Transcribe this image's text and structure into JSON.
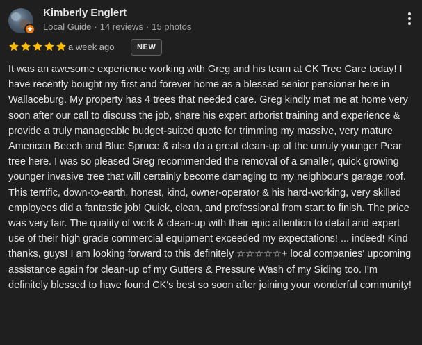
{
  "review": {
    "author": {
      "name": "Kimberly Englert",
      "badge": "Local Guide",
      "reviews": "14 reviews",
      "photos": "15 photos",
      "separator": "·"
    },
    "rating": {
      "stars": 5,
      "max": 5,
      "color": "#fbbc04"
    },
    "date": "a week ago",
    "new_badge": "NEW",
    "text": "It was an awesome experience working with Greg and his team at CK Tree Care today! I have recently bought my first and forever home as a blessed senior pensioner here in Wallaceburg. My property has 4 trees that needed care. Greg kindly met me at home very soon after our call to discuss the job, share his expert arborist training and experience & provide a truly manageable budget-suited quote for trimming my massive, very mature American Beech and Blue Spruce & also do a great clean-up of the unruly younger Pear tree here. I was so pleased Greg recommended the removal of a smaller, quick growing younger invasive tree that will certainly become damaging to my neighbour's garage roof. This terrific, down-to-earth, honest, kind, owner-operator & his hard-working, very skilled employees did a fantastic job! Quick, clean, and professional from start to finish. The price was very fair. The quality of work & clean-up with their epic attention to detail and expert use of their high grade commercial equipment exceeded my expectations! ... indeed! Kind thanks, guys! I am looking forward to this definitely ☆☆☆☆☆+ local companies' upcoming assistance again for clean-up of my Gutters & Pressure Wash of my Siding too. I'm definitely blessed to have found CK's best so soon after joining your wonderful community!"
  },
  "icons": {
    "avatar": "profile-photo",
    "guide_badge": "local-guide-badge-icon",
    "star": "star-icon",
    "more": "more-vert-icon"
  },
  "colors": {
    "background": "#1f1f1f",
    "text": "#e3e3e3",
    "secondary_text": "#a8a8a8",
    "local_guide_badge": "#e8710a"
  }
}
